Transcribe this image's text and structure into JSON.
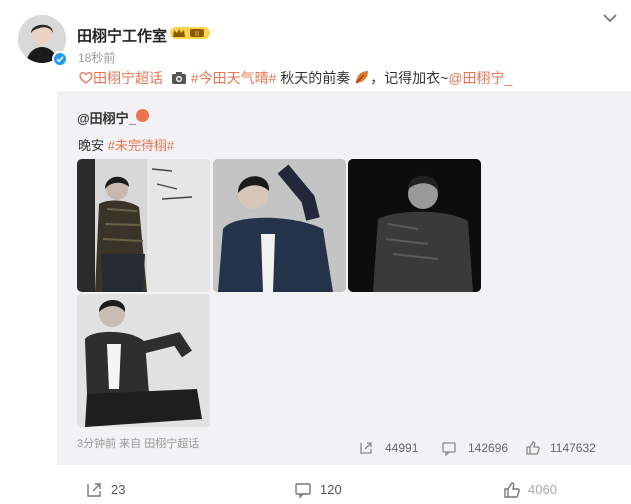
{
  "post": {
    "author": "田栩宁工作室",
    "time": "18秒前",
    "text_parts": [
      {
        "kind": "topic",
        "text": "田栩宁超话"
      },
      {
        "kind": "topic",
        "text": "#今田天气晴#"
      },
      {
        "kind": "plain",
        "text": " 秋天的前奏"
      },
      {
        "kind": "plain",
        "text": "，记得加衣~"
      },
      {
        "kind": "mention",
        "text": "@田栩宁_"
      }
    ]
  },
  "repost": {
    "user": "@田栩宁_",
    "text_plain": "晚安 ",
    "text_topic": "#未完待栩#",
    "meta": "3分钟前 来自 田栩宁超话",
    "stats": {
      "reposts": "44991",
      "comments": "142696",
      "likes": "1147632"
    }
  },
  "footer": {
    "reposts": "23",
    "comments": "120",
    "likes": "4060"
  },
  "colors": {
    "accent": "#eb7350",
    "panel": "#f2f2f5",
    "verified": "#1e9bf0"
  },
  "icons": [
    "chevron-down-icon",
    "verified-icon",
    "vip-badge-icon",
    "super-topic-icon",
    "camera-icon",
    "leaf-icon",
    "repost-icon",
    "comment-icon",
    "like-icon"
  ]
}
